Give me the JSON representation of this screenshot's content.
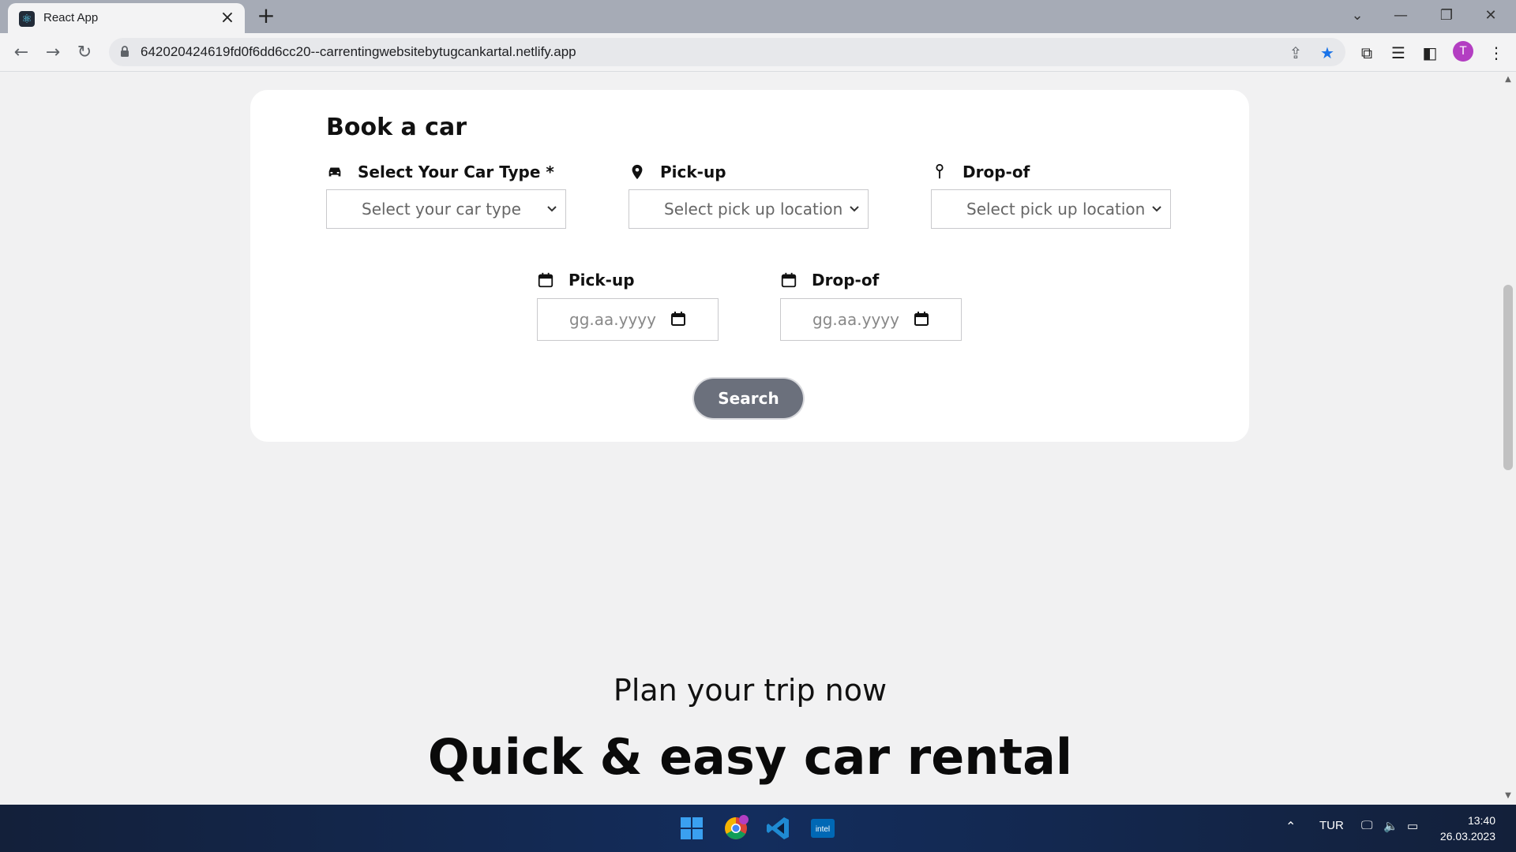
{
  "browser": {
    "tab_title": "React App",
    "tab_close": "×",
    "new_tab": "+",
    "url": "642020424619fd0f6dd6cc20--carrentingwebsitebytugcankartal.netlify.app",
    "profile_initial": "T",
    "window_controls": {
      "dropdown": "⌄",
      "minimize": "—",
      "restore": "❐",
      "close": "✕"
    }
  },
  "booking": {
    "title": "Book a car",
    "car_type_label": "Select Your Car Type *",
    "car_type_value": "Select your car type",
    "pickup_label": "Pick-up",
    "pickup_value": "Select pick up location",
    "dropoff_label": "Drop-of",
    "dropoff_value": "Select pick up location",
    "pickup_date_label": "Pick-up",
    "pickup_date_placeholder": "gg.aa.yyyy",
    "dropoff_date_label": "Drop-of",
    "dropoff_date_placeholder": "gg.aa.yyyy",
    "search_label": "Search"
  },
  "hero": {
    "subtitle": "Plan your trip now",
    "title": "Quick & easy car rental"
  },
  "taskbar": {
    "language": "TUR",
    "time": "13:40",
    "date": "26.03.2023"
  },
  "colors": {
    "tabbar": "#a6abb6",
    "page_bg": "#f1f1f2",
    "search_button": "#6b707c",
    "profile": "#b33ec2"
  }
}
